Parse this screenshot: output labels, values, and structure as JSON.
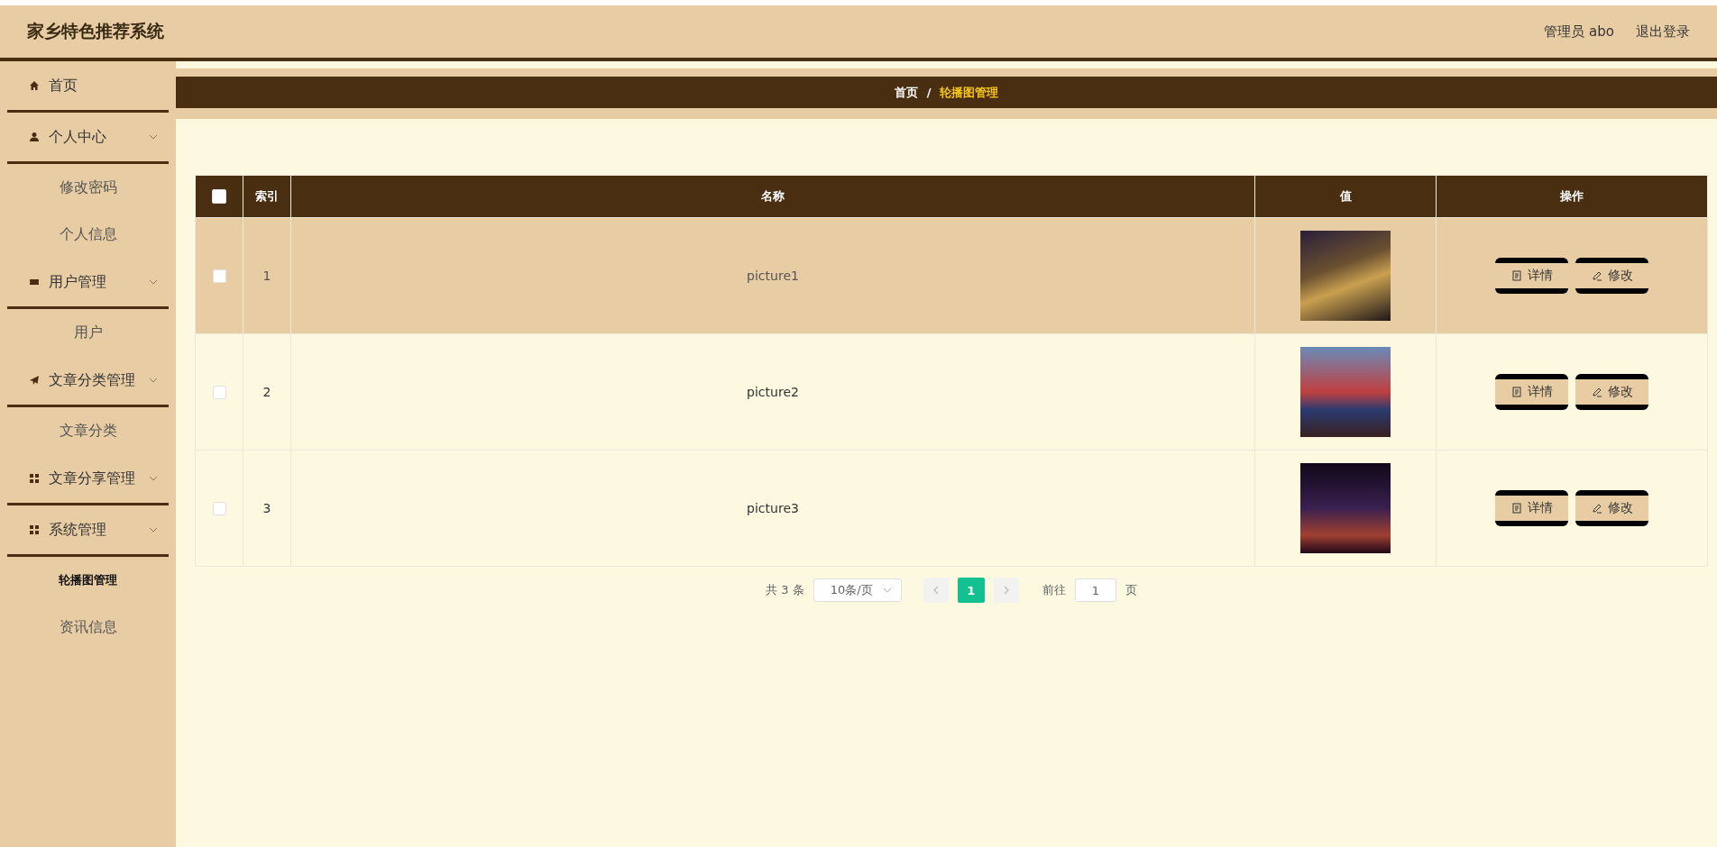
{
  "header": {
    "title": "家乡特色推荐系统",
    "user": "管理员 abo",
    "logout": "退出登录"
  },
  "sidebar": {
    "items": [
      {
        "label": "首页",
        "kind": "link"
      },
      {
        "label": "个人中心",
        "kind": "group",
        "children": [
          {
            "label": "修改密码",
            "selected": false
          },
          {
            "label": "个人信息",
            "selected": false
          }
        ]
      },
      {
        "label": "用户管理",
        "kind": "group",
        "children": [
          {
            "label": "用户",
            "selected": false
          }
        ]
      },
      {
        "label": "文章分类管理",
        "kind": "group",
        "children": [
          {
            "label": "文章分类",
            "selected": false
          }
        ]
      },
      {
        "label": "文章分享管理",
        "kind": "group"
      },
      {
        "label": "系统管理",
        "kind": "group",
        "children": [
          {
            "label": "轮播图管理",
            "selected": true
          },
          {
            "label": "资讯信息",
            "selected": false
          }
        ]
      }
    ]
  },
  "breadcrumb": [
    {
      "label": "首页",
      "current": false
    },
    {
      "label": "轮播图管理",
      "current": true
    }
  ],
  "breadcrumb_separator": "/",
  "table": {
    "select_all_checked": false,
    "columns": [
      "索引",
      "名称",
      "值",
      "操作"
    ],
    "rows": [
      {
        "index": "1",
        "name": "picture1",
        "checked": false,
        "hovered": true,
        "actions": [
          "详情",
          "修改"
        ]
      },
      {
        "index": "2",
        "name": "picture2",
        "checked": false,
        "hovered": false,
        "actions": [
          "详情",
          "修改"
        ]
      },
      {
        "index": "3",
        "name": "picture3",
        "checked": false,
        "hovered": false,
        "actions": [
          "详情",
          "修改"
        ]
      }
    ]
  },
  "pagination": {
    "total": "共 3 条",
    "page_size": "10条/页",
    "pages": [
      {
        "label": "1",
        "selected": true
      }
    ],
    "goto_label": "前往",
    "goto_value": "1",
    "goto_suffix": "页"
  }
}
